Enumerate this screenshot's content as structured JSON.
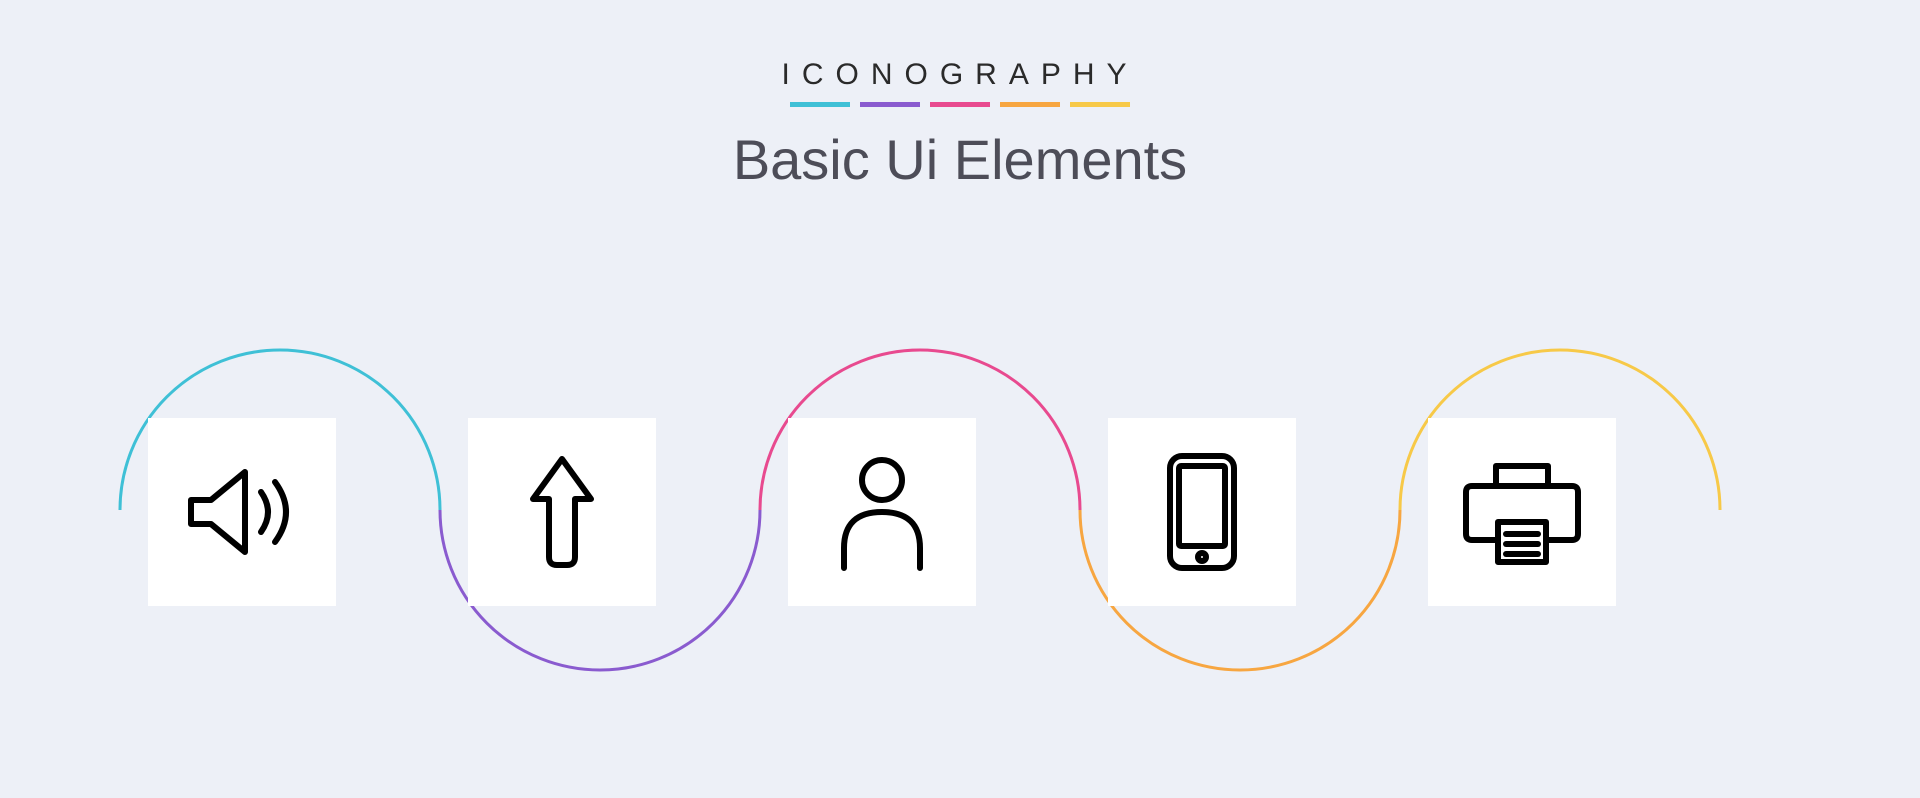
{
  "brand": "ICONOGRAPHY",
  "title": "Basic Ui Elements",
  "accents": [
    "#3fc0d6",
    "#8a5bcf",
    "#e84a8f",
    "#f7a641",
    "#f7c948"
  ],
  "icons": [
    {
      "name": "speaker-icon"
    },
    {
      "name": "arrow-up-icon"
    },
    {
      "name": "user-icon"
    },
    {
      "name": "phone-icon"
    },
    {
      "name": "printer-icon"
    }
  ]
}
